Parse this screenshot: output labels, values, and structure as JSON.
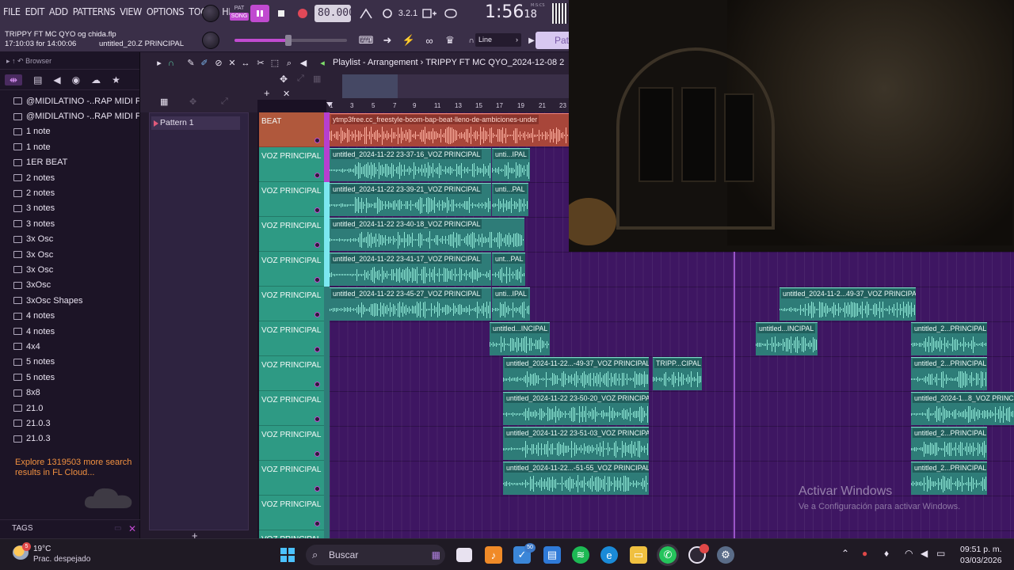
{
  "menu": [
    "FILE",
    "EDIT",
    "ADD",
    "PATTERNS",
    "VIEW",
    "OPTIONS",
    "TOOLS",
    "HELP"
  ],
  "transport": {
    "pat_label": "PAT",
    "song_label": "SONG",
    "tempo": "80.000",
    "time_main": "1:56",
    "time_sub": "18",
    "time_unit": "M:S:CS",
    "snap_label": "Line",
    "pattern_box": "Patt"
  },
  "project": {
    "file": "TRIPPY FT MC QYO og chida.flp",
    "time": "17:10:03 for 14:00:06",
    "hint": "untitled_20.Z PRINCIPAL"
  },
  "browser": {
    "title": "Browser",
    "items": [
      "@MIDILATINO -..RAP MIDI PACK",
      "@MIDILATINO -..RAP MIDI PACK",
      "1 note",
      "1 note",
      "1ER BEAT",
      "2 notes",
      "2 notes",
      "3 notes",
      "3 notes",
      "3x Osc",
      "3x Osc",
      "3x Osc",
      "3xOsc",
      "3xOsc Shapes",
      "4 notes",
      "4 notes",
      "4x4",
      "5 notes",
      "5 notes",
      "8x8",
      "21.0",
      "21.0.3",
      "21.0.3"
    ],
    "cloud_message": "Explore 1319503 more search results in FL Cloud...",
    "tags_label": "TAGS"
  },
  "patterns": {
    "items": [
      "Pattern 1"
    ]
  },
  "playlist": {
    "title": "Playlist - Arrangement",
    "crumb": "TRIPPY FT MC QYO_2024-12-08 2",
    "ruler": [
      "1",
      "3",
      "5",
      "7",
      "9",
      "11",
      "13",
      "15",
      "17",
      "19",
      "21",
      "23"
    ],
    "tracks": [
      {
        "name": "BEAT"
      },
      {
        "name": "VOZ PRINCIPAL"
      },
      {
        "name": "VOZ PRINCIPAL"
      },
      {
        "name": "VOZ PRINCIPAL"
      },
      {
        "name": "VOZ PRINCIPAL"
      },
      {
        "name": "VOZ PRINCIPAL"
      },
      {
        "name": "VOZ PRINCIPAL"
      },
      {
        "name": "VOZ PRINCIPAL"
      },
      {
        "name": "VOZ PRINCIPAL"
      },
      {
        "name": "VOZ PRINCIPAL"
      },
      {
        "name": "VOZ PRINCIPAL"
      },
      {
        "name": "VOZ PRINCIPAL"
      },
      {
        "name": "VOZ PRINCIPAL"
      }
    ],
    "clips": [
      {
        "label": "ytmp3free.cc_freestyle-boom-bap-beat-lleno-de-ambiciones-under"
      },
      {
        "label": "untitled_2024-11-22 23-37-16_VOZ PRINCIPAL"
      },
      {
        "label": "unti...IPAL"
      },
      {
        "label": "untitled_2024-11-22 23-39-21_VOZ PRINCIPAL"
      },
      {
        "label": "unti...PAL"
      },
      {
        "label": "untitled_2024-11-22 23-40-18_VOZ PRINCIPAL"
      },
      {
        "label": "untitled_2024-11-22 23-41-17_VOZ PRINCIPAL"
      },
      {
        "label": "unt...PAL"
      },
      {
        "label": "untitled_2024-11-22 23-45-27_VOZ PRINCIPAL"
      },
      {
        "label": "unti...IPAL"
      },
      {
        "label": "untitled_2024-11-2...49-37_VOZ PRINCIPAL"
      },
      {
        "label": "untitled...INCIPAL"
      },
      {
        "label": "untitled...INCIPAL"
      },
      {
        "label": "untitled_2...PRINCIPAL"
      },
      {
        "label": "untitled_2024-11-22...-49-37_VOZ PRINCIPAL"
      },
      {
        "label": "TRIPP...CIPAL"
      },
      {
        "label": "untitled_2...PRINCIPAL"
      },
      {
        "label": "untitled_2024-11-22 23-50-20_VOZ PRINCIPAL"
      },
      {
        "label": "untitled_2024-1...8_VOZ PRINCIPAL"
      },
      {
        "label": "untitled_2024-11-22 23-51-03_VOZ PRINCIPAL"
      },
      {
        "label": "untitled_2...PRINCIPAL"
      },
      {
        "label": "untitled_2024-11-22...-51-55_VOZ PRINCIPAL"
      },
      {
        "label": "untitled_2...PRINCIPAL"
      }
    ]
  },
  "watermark": {
    "line1": "Activar Windows",
    "line2": "Ve a Configuración para activar Windows."
  },
  "taskbar": {
    "temp": "19°C",
    "weather": "Prac. despejado",
    "weather_badge": "5",
    "search": "Buscar",
    "badge": "50",
    "time": "09:51 p. m.",
    "date": "03/03/2026"
  }
}
